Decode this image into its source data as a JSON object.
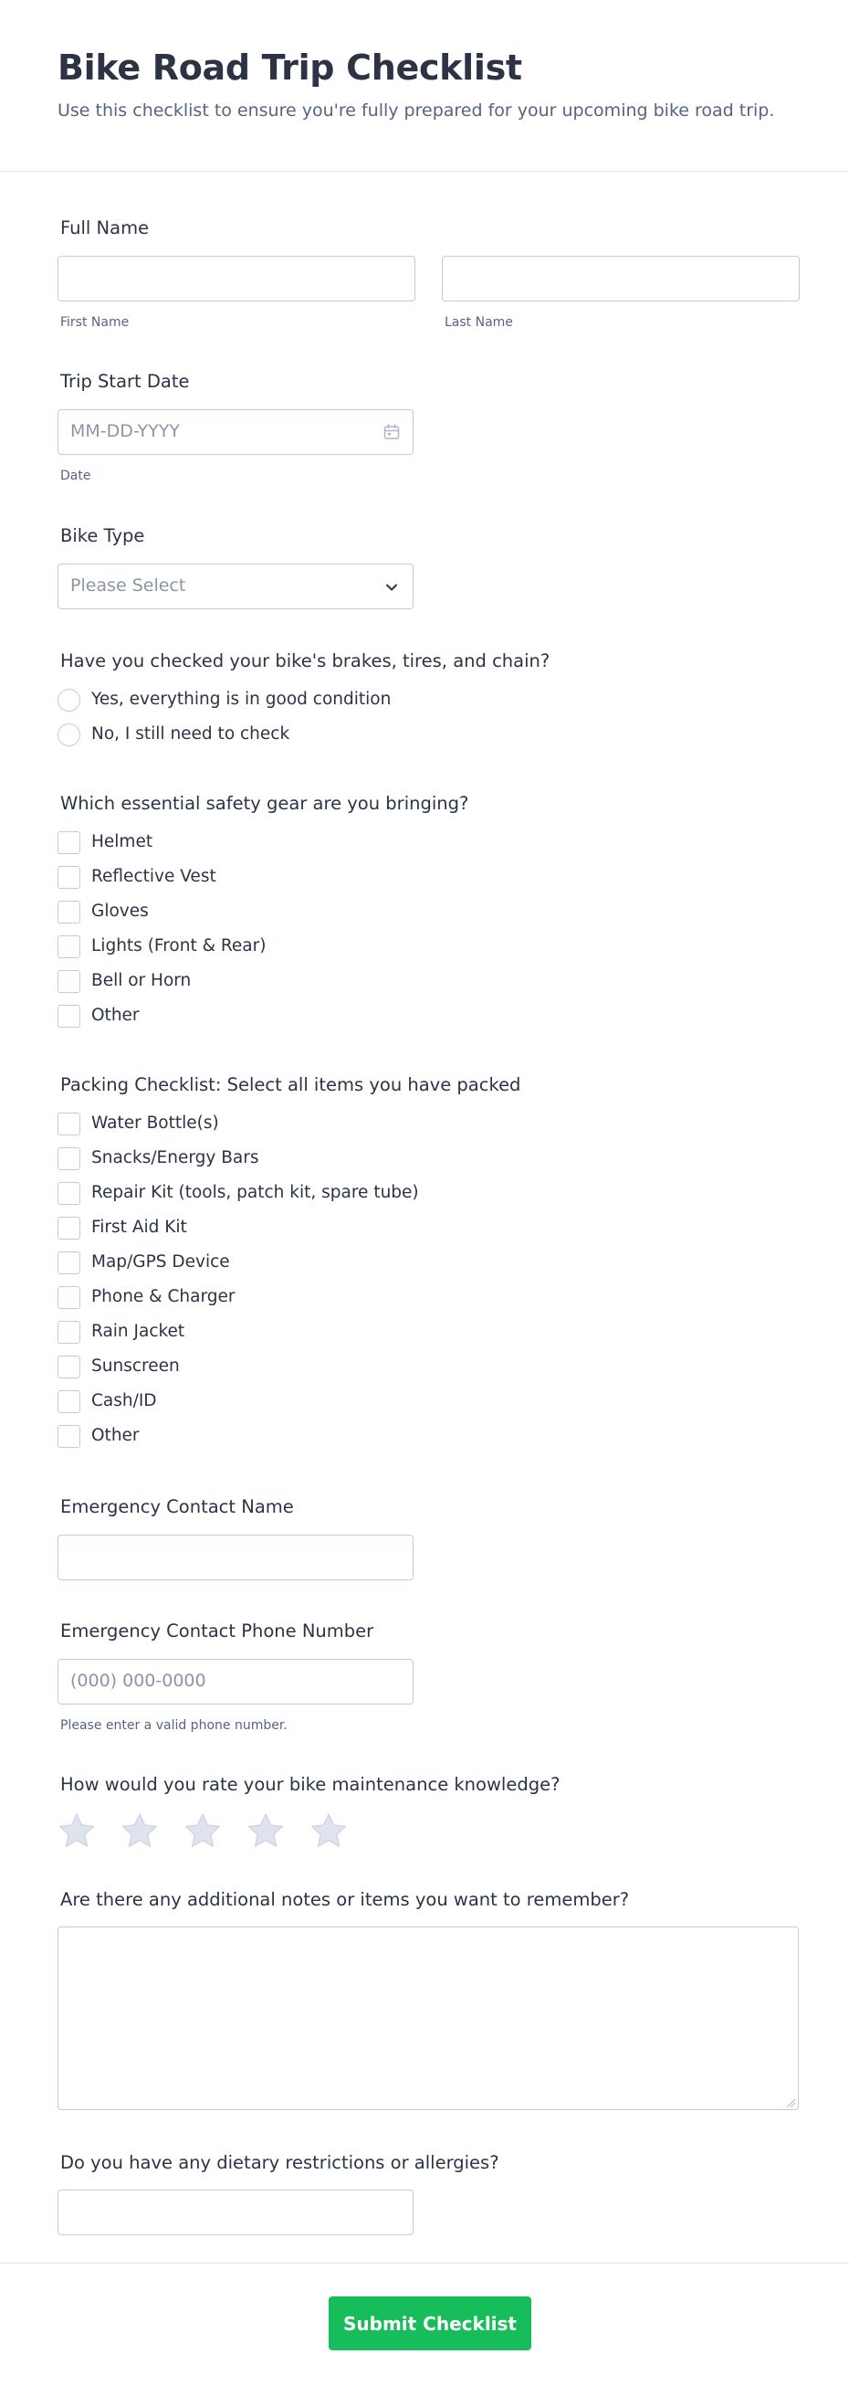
{
  "form": {
    "title": "Bike Road Trip Checklist",
    "subtitle": "Use this checklist to ensure you're fully prepared for your upcoming bike road trip."
  },
  "full_name": {
    "label": "Full Name",
    "first_sublabel": "First Name",
    "last_sublabel": "Last Name"
  },
  "trip_date": {
    "label": "Trip Start Date",
    "placeholder": "MM-DD-YYYY",
    "sublabel": "Date",
    "icon": "calendar-icon"
  },
  "bike_type": {
    "label": "Bike Type",
    "placeholder": "Please Select",
    "icon": "chevron-down-icon"
  },
  "bike_check": {
    "label": "Have you checked your bike's brakes, tires, and chain?",
    "options": [
      "Yes, everything is in good condition",
      "No, I still need to check"
    ]
  },
  "safety_gear": {
    "label": "Which essential safety gear are you bringing?",
    "options": [
      "Helmet",
      "Reflective Vest",
      "Gloves",
      "Lights (Front & Rear)",
      "Bell or Horn",
      "Other"
    ]
  },
  "packing": {
    "label": "Packing Checklist: Select all items you have packed",
    "options": [
      "Water Bottle(s)",
      "Snacks/Energy Bars",
      "Repair Kit (tools, patch kit, spare tube)",
      "First Aid Kit",
      "Map/GPS Device",
      "Phone & Charger",
      "Rain Jacket",
      "Sunscreen",
      "Cash/ID",
      "Other"
    ]
  },
  "emergency_name": {
    "label": "Emergency Contact Name"
  },
  "emergency_phone": {
    "label": "Emergency Contact Phone Number",
    "placeholder": "(000) 000-0000",
    "sublabel": "Please enter a valid phone number."
  },
  "rating": {
    "label": "How would you rate your bike maintenance knowledge?",
    "max_stars": 5,
    "selected": 0,
    "star_color": "#dfe3ee"
  },
  "notes": {
    "label": "Are there any additional notes or items you want to remember?"
  },
  "dietary": {
    "label": "Do you have any dietary restrictions or allergies?"
  },
  "submit": {
    "label": "Submit Checklist",
    "color": "#18bd5b"
  }
}
